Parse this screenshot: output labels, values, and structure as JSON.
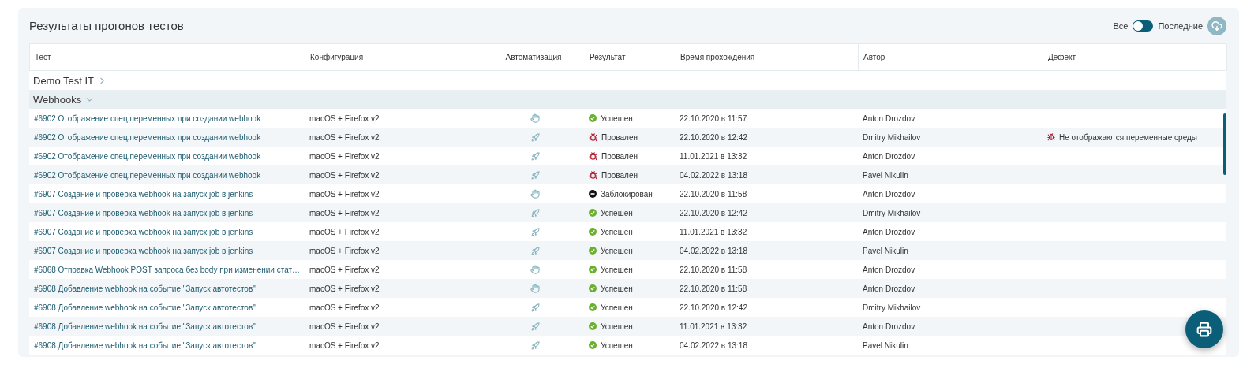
{
  "title": "Результаты прогонов тестов",
  "filter": {
    "left_label": "Все",
    "right_label": "Последние",
    "on": false
  },
  "columns": [
    "Тест",
    "Конфигурация",
    "Автоматизация",
    "Результат",
    "Время прохождения",
    "Автор",
    "Дефект"
  ],
  "groups": [
    {
      "name": "Demo Test IT",
      "expanded": false
    },
    {
      "name": "Webhooks",
      "expanded": true,
      "rows": [
        {
          "test": "#6902 Отображение спец.переменных при создании webhook",
          "config": "macOS + Firefox v2",
          "automation": {
            "kind": "manual"
          },
          "result": {
            "kind": "passed",
            "label": "Успешен"
          },
          "time": "22.10.2020 в 11:57",
          "author": "Anton Drozdov"
        },
        {
          "test": "#6902 Отображение спец.переменных при создании webhook",
          "config": "macOS + Firefox v2",
          "automation": {
            "kind": "auto"
          },
          "result": {
            "kind": "failed",
            "label": "Провален"
          },
          "time": "22.10.2020 в 12:42",
          "author": "Dmitry Mikhailov",
          "defect": "Не отображаются переменные среды"
        },
        {
          "test": "#6902 Отображение спец.переменных при создании webhook",
          "config": "macOS + Firefox v2",
          "automation": {
            "kind": "auto"
          },
          "result": {
            "kind": "failed",
            "label": "Провален"
          },
          "time": "11.01.2021 в 13:32",
          "author": "Anton Drozdov"
        },
        {
          "test": "#6902 Отображение спец.переменных при создании webhook",
          "config": "macOS + Firefox v2",
          "automation": {
            "kind": "auto"
          },
          "result": {
            "kind": "failed",
            "label": "Провален"
          },
          "time": "04.02.2022 в 13:18",
          "author": "Pavel Nikulin"
        },
        {
          "test": "#6907 Создание и проверка webhook на запуск job в jenkins",
          "config": "macOS + Firefox v2",
          "automation": {
            "kind": "manual"
          },
          "result": {
            "kind": "blocked",
            "label": "Заблокирован"
          },
          "time": "22.10.2020 в 11:58",
          "author": "Anton Drozdov"
        },
        {
          "test": "#6907 Создание и проверка webhook на запуск job в jenkins",
          "config": "macOS + Firefox v2",
          "automation": {
            "kind": "auto"
          },
          "result": {
            "kind": "passed",
            "label": "Успешен"
          },
          "time": "22.10.2020 в 12:42",
          "author": "Dmitry Mikhailov"
        },
        {
          "test": "#6907 Создание и проверка webhook на запуск job в jenkins",
          "config": "macOS + Firefox v2",
          "automation": {
            "kind": "auto"
          },
          "result": {
            "kind": "passed",
            "label": "Успешен"
          },
          "time": "11.01.2021 в 13:32",
          "author": "Anton Drozdov"
        },
        {
          "test": "#6907 Создание и проверка webhook на запуск job в jenkins",
          "config": "macOS + Firefox v2",
          "automation": {
            "kind": "auto"
          },
          "result": {
            "kind": "passed",
            "label": "Успешен"
          },
          "time": "04.02.2022 в 13:18",
          "author": "Pavel Nikulin"
        },
        {
          "test": "#6068 Отправка Webhook POST запроса без body при изменении стат…",
          "config": "macOS + Firefox v2",
          "automation": {
            "kind": "manual"
          },
          "result": {
            "kind": "passed",
            "label": "Успешен"
          },
          "time": "22.10.2020 в 11:58",
          "author": "Anton Drozdov"
        },
        {
          "test": "#6908 Добавление webhook на событие \"Запуск автотестов\"",
          "config": "macOS + Firefox v2",
          "automation": {
            "kind": "manual"
          },
          "result": {
            "kind": "passed",
            "label": "Успешен"
          },
          "time": "22.10.2020 в 11:58",
          "author": "Anton Drozdov"
        },
        {
          "test": "#6908 Добавление webhook на событие \"Запуск автотестов\"",
          "config": "macOS + Firefox v2",
          "automation": {
            "kind": "auto"
          },
          "result": {
            "kind": "passed",
            "label": "Успешен"
          },
          "time": "22.10.2020 в 12:42",
          "author": "Dmitry Mikhailov"
        },
        {
          "test": "#6908 Добавление webhook на событие \"Запуск автотестов\"",
          "config": "macOS + Firefox v2",
          "automation": {
            "kind": "auto"
          },
          "result": {
            "kind": "passed",
            "label": "Успешен"
          },
          "time": "11.01.2021 в 13:32",
          "author": "Anton Drozdov"
        },
        {
          "test": "#6908 Добавление webhook на событие \"Запуск автотестов\"",
          "config": "macOS + Firefox v2",
          "automation": {
            "kind": "auto"
          },
          "result": {
            "kind": "passed",
            "label": "Успешен"
          },
          "time": "04.02.2022 в 13:18",
          "author": "Pavel Nikulin"
        }
      ]
    }
  ]
}
